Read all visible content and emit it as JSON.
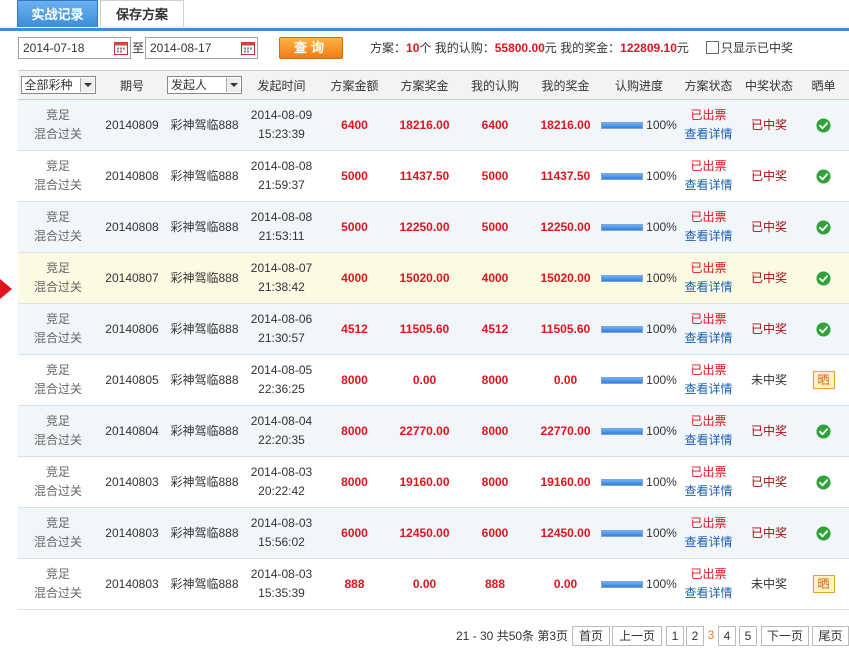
{
  "tabs": [
    {
      "label": "实战记录",
      "active": true
    },
    {
      "label": "保存方案",
      "active": false
    }
  ],
  "filter": {
    "start_date": "2014-07-18",
    "to_label": "至",
    "end_date": "2014-08-17",
    "query_label": "查询",
    "summary": {
      "plan_label": "方案：",
      "plan_count": "10",
      "plan_unit": "个",
      "my_sub_label": " 我的认购：",
      "my_sub_amount": "55800.00",
      "yuan1": "元",
      "my_prize_label": " 我的奖金：",
      "my_prize_amount": "122809.10",
      "yuan2": "元"
    },
    "win_only_label": "只显示已中奖",
    "win_only_checked": false
  },
  "table": {
    "headers": {
      "lottery_select": "全部彩种",
      "issue": "期号",
      "initiator_select": "发起人",
      "time": "发起时间",
      "plan_amount": "方案金额",
      "plan_prize": "方案奖金",
      "my_sub": "我的认购",
      "my_prize": "我的奖金",
      "progress": "认购进度",
      "plan_status": "方案状态",
      "win_status": "中奖状态",
      "share": "晒单"
    },
    "rows": [
      {
        "type1": "竞足",
        "type2": "混合过关",
        "issue": "20140809",
        "initiator": "彩神驾临888",
        "date": "2014-08-09",
        "time": "15:23:39",
        "plan_amount": "6400",
        "plan_prize": "18216.00",
        "my_sub": "6400",
        "my_prize": "18216.00",
        "progress": "100%",
        "status": "已出票",
        "detail": "查看详情",
        "win": "已中奖",
        "share": "check"
      },
      {
        "type1": "竞足",
        "type2": "混合过关",
        "issue": "20140808",
        "initiator": "彩神驾临888",
        "date": "2014-08-08",
        "time": "21:59:37",
        "plan_amount": "5000",
        "plan_prize": "11437.50",
        "my_sub": "5000",
        "my_prize": "11437.50",
        "progress": "100%",
        "status": "已出票",
        "detail": "查看详情",
        "win": "已中奖",
        "share": "check"
      },
      {
        "type1": "竞足",
        "type2": "混合过关",
        "issue": "20140808",
        "initiator": "彩神驾临888",
        "date": "2014-08-08",
        "time": "21:53:11",
        "plan_amount": "5000",
        "plan_prize": "12250.00",
        "my_sub": "5000",
        "my_prize": "12250.00",
        "progress": "100%",
        "status": "已出票",
        "detail": "查看详情",
        "win": "已中奖",
        "share": "check"
      },
      {
        "type1": "竞足",
        "type2": "混合过关",
        "issue": "20140807",
        "initiator": "彩神驾临888",
        "date": "2014-08-07",
        "time": "21:38:42",
        "plan_amount": "4000",
        "plan_prize": "15020.00",
        "my_sub": "4000",
        "my_prize": "15020.00",
        "progress": "100%",
        "status": "已出票",
        "detail": "查看详情",
        "win": "已中奖",
        "share": "check"
      },
      {
        "type1": "竞足",
        "type2": "混合过关",
        "issue": "20140806",
        "initiator": "彩神驾临888",
        "date": "2014-08-06",
        "time": "21:30:57",
        "plan_amount": "4512",
        "plan_prize": "11505.60",
        "my_sub": "4512",
        "my_prize": "11505.60",
        "progress": "100%",
        "status": "已出票",
        "detail": "查看详情",
        "win": "已中奖",
        "share": "check"
      },
      {
        "type1": "竞足",
        "type2": "混合过关",
        "issue": "20140805",
        "initiator": "彩神驾临888",
        "date": "2014-08-05",
        "time": "22:36:25",
        "plan_amount": "8000",
        "plan_prize": "0.00",
        "my_sub": "8000",
        "my_prize": "0.00",
        "progress": "100%",
        "status": "已出票",
        "detail": "查看详情",
        "win": "未中奖",
        "share": "晒"
      },
      {
        "type1": "竞足",
        "type2": "混合过关",
        "issue": "20140804",
        "initiator": "彩神驾临888",
        "date": "2014-08-04",
        "time": "22:20:35",
        "plan_amount": "8000",
        "plan_prize": "22770.00",
        "my_sub": "8000",
        "my_prize": "22770.00",
        "progress": "100%",
        "status": "已出票",
        "detail": "查看详情",
        "win": "已中奖",
        "share": "check"
      },
      {
        "type1": "竞足",
        "type2": "混合过关",
        "issue": "20140803",
        "initiator": "彩神驾临888",
        "date": "2014-08-03",
        "time": "20:22:42",
        "plan_amount": "8000",
        "plan_prize": "19160.00",
        "my_sub": "8000",
        "my_prize": "19160.00",
        "progress": "100%",
        "status": "已出票",
        "detail": "查看详情",
        "win": "已中奖",
        "share": "check"
      },
      {
        "type1": "竞足",
        "type2": "混合过关",
        "issue": "20140803",
        "initiator": "彩神驾临888",
        "date": "2014-08-03",
        "time": "15:56:02",
        "plan_amount": "6000",
        "plan_prize": "12450.00",
        "my_sub": "6000",
        "my_prize": "12450.00",
        "progress": "100%",
        "status": "已出票",
        "detail": "查看详情",
        "win": "已中奖",
        "share": "check"
      },
      {
        "type1": "竞足",
        "type2": "混合过关",
        "issue": "20140803",
        "initiator": "彩神驾临888",
        "date": "2014-08-03",
        "time": "15:35:39",
        "plan_amount": "888",
        "plan_prize": "0.00",
        "my_sub": "888",
        "my_prize": "0.00",
        "progress": "100%",
        "status": "已出票",
        "detail": "查看详情",
        "win": "未中奖",
        "share": "晒"
      }
    ],
    "highlighted_row": 3
  },
  "pager": {
    "info": "21 - 30 共50条 第3页",
    "first": "首页",
    "prev": "上一页",
    "pages": [
      "1",
      "2",
      "3",
      "4",
      "5"
    ],
    "current": "3",
    "next": "下一页",
    "last": "尾页"
  },
  "colors": {
    "accent_blue": "#3c8ed8",
    "red": "#e0141c",
    "orange": "#f07c14",
    "green": "#2fa33a"
  }
}
